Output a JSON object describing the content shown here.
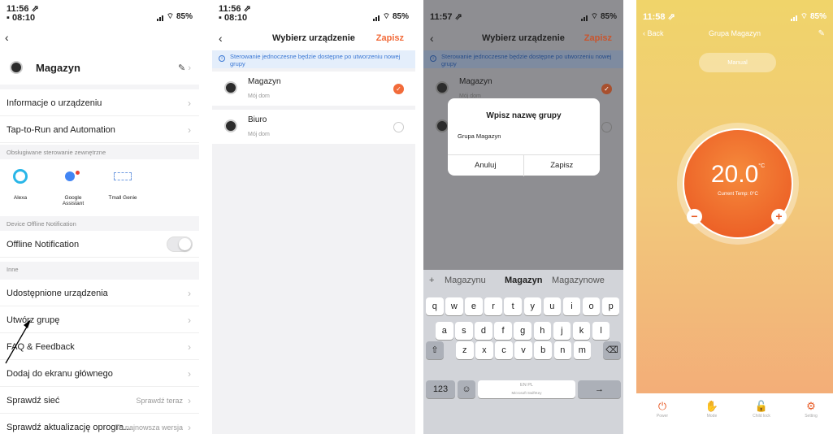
{
  "panel1": {
    "time": "11:56 ⇗",
    "time2": "▪ 08:10",
    "battery": "⌔ 85%",
    "device_name": "Magazyn",
    "rows": [
      {
        "label": "Informacje o urządzeniu"
      },
      {
        "label": "Tap-to-Run and Automation"
      }
    ],
    "section_external": "Obsługiwane sterowanie zewnętrzne",
    "assistants": [
      "Alexa",
      "Google Assistant",
      "Tmall Genie"
    ],
    "section_offline": "Device Offline Notification",
    "offline_label": "Offline Notification",
    "section_other": "Inne",
    "rows2": [
      {
        "label": "Udostępnione urządzenia",
        "value": ""
      },
      {
        "label": "Utwórz grupę",
        "value": ""
      },
      {
        "label": "FAQ & Feedback",
        "value": ""
      },
      {
        "label": "Dodaj do ekranu głównego",
        "value": ""
      },
      {
        "label": "Sprawdź sieć",
        "value": "Sprawdź teraz"
      },
      {
        "label": "Sprawdź aktualizację oprogra...",
        "value": "To najnowsza wersja"
      }
    ]
  },
  "panel2": {
    "time": "11:56 ⇗",
    "time2": "▪ 08:10",
    "battery": "⌔ 85%",
    "title": "Wybierz urządzenie",
    "save": "Zapisz",
    "note": "Sterowanie jednoczesne będzie dostępne po utworzeniu nowej grupy",
    "devices": [
      {
        "name": "Magazyn",
        "sub": "Mój dom",
        "checked": true
      },
      {
        "name": "Biuro",
        "sub": "Mój dom",
        "checked": false
      }
    ]
  },
  "panel3": {
    "time": "11:57 ⇗",
    "battery": "⌔ 85%",
    "title": "Wybierz urządzenie",
    "save": "Zapisz",
    "note": "Sterowanie jednoczesne będzie dostępne po utworzeniu nowej grupy",
    "devices": [
      {
        "name": "Magazyn",
        "sub": "Mój dom"
      },
      {
        "name": "Biuro",
        "sub": ""
      }
    ],
    "dialog_title": "Wpisz nazwę grupy",
    "dialog_value": "Grupa Magazyn",
    "cancel": "Anuluj",
    "confirm": "Zapisz",
    "suggestions": [
      "+",
      "Magazynu",
      "Magazyn",
      "Magazynowe"
    ],
    "row1": [
      "q",
      "w",
      "e",
      "r",
      "t",
      "y",
      "u",
      "i",
      "o",
      "p"
    ],
    "row2": [
      "a",
      "s",
      "d",
      "f",
      "g",
      "h",
      "j",
      "k",
      "l"
    ],
    "row3": [
      "z",
      "x",
      "c",
      "v",
      "b",
      "n",
      "m"
    ],
    "num_key": "123",
    "emoji": "☺",
    "space_top": "EN PL",
    "space_bottom": "Microsoft SwiftKey",
    "return": "→",
    "backspace": "⌫",
    "shift": "⇧"
  },
  "panel4": {
    "time": "11:58 ⇗",
    "battery": "⌔ 85%",
    "back": "‹ Back",
    "title": "Grupa Magazyn",
    "mode": "Manual",
    "temperature": "20.0",
    "unit": "°C",
    "current": "Current Temp: 0°C",
    "tabs": [
      "Power",
      "Mode",
      "Child lock",
      "Setting"
    ]
  }
}
